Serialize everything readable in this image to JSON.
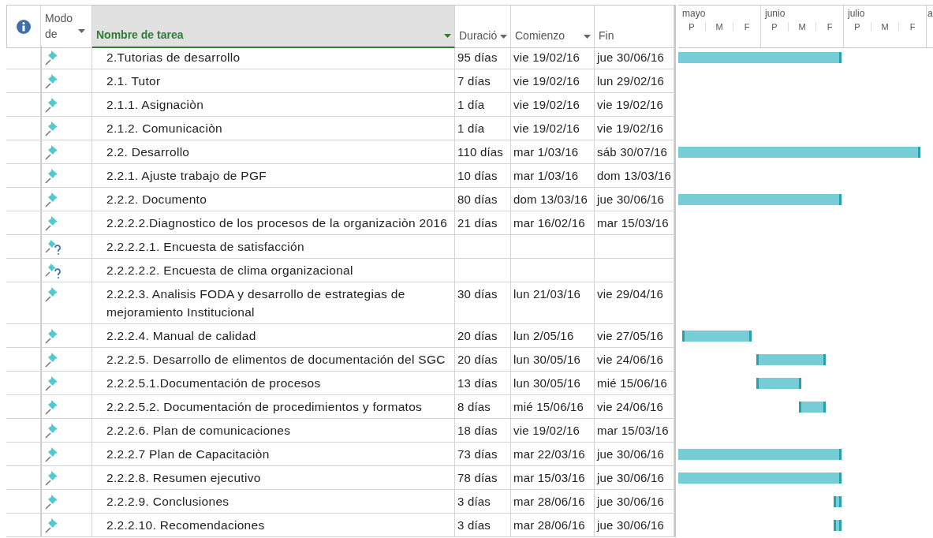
{
  "columns": [
    {
      "label": "Modo de",
      "dropdown": true,
      "selected": false
    },
    {
      "label": "Nombre de tarea",
      "dropdown": true,
      "selected": true
    },
    {
      "label": "Duració",
      "dropdown": true,
      "selected": false
    },
    {
      "label": "Comienzo",
      "dropdown": true,
      "selected": false
    },
    {
      "label": "Fin",
      "dropdown": false,
      "selected": false
    }
  ],
  "timescale": [
    {
      "month": "mayo",
      "ticks": [
        "P",
        "M",
        "F"
      ]
    },
    {
      "month": "junio",
      "ticks": [
        "P",
        "M",
        "F"
      ]
    },
    {
      "month": "julio",
      "ticks": [
        "P",
        "M",
        "F"
      ]
    },
    {
      "month": "a"
    }
  ],
  "tasks": [
    {
      "kind": "pin",
      "name": "2.Tutorias de desarrollo",
      "duration": "95 días",
      "start": "vie 19/02/16",
      "finish": "jue 30/06/16"
    },
    {
      "kind": "pin",
      "name": "2.1. Tutor",
      "duration": "7 días",
      "start": "vie 19/02/16",
      "finish": "lun 29/02/16"
    },
    {
      "kind": "pin",
      "name": "2.1.1. Asignaciòn",
      "duration": "1 día",
      "start": "vie 19/02/16",
      "finish": "vie 19/02/16"
    },
    {
      "kind": "pin",
      "name": "2.1.2. Comunicaciòn",
      "duration": "1 día",
      "start": "vie 19/02/16",
      "finish": "vie 19/02/16"
    },
    {
      "kind": "pin",
      "name": "2.2. Desarrollo",
      "duration": "110 días",
      "start": "mar 1/03/16",
      "finish": "sáb 30/07/16"
    },
    {
      "kind": "pin",
      "name": "2.2.1. Ajuste  trabajo de PGF",
      "duration": "10 días",
      "start": "mar 1/03/16",
      "finish": "dom 13/03/16"
    },
    {
      "kind": "pin",
      "name": "2.2.2. Documento",
      "duration": "80 días",
      "start": "dom 13/03/16",
      "finish": "jue 30/06/16"
    },
    {
      "kind": "pin",
      "name": "2.2.2.2.Diagnostico de los procesos de la organizaciòn  2016",
      "duration": "21 días",
      "start": "mar 16/02/16",
      "finish": "mar 15/03/16"
    },
    {
      "kind": "pin-question",
      "name": "2.2.2.2.1. Encuesta de satisfacción"
    },
    {
      "kind": "pin-question",
      "name": "2.2.2.2.2. Encuesta de clima organizacional"
    },
    {
      "kind": "pin",
      "name": "2.2.2.3. Analisis FODA y desarrollo de estrategias de mejoramiento Institucional",
      "duration": "30 días",
      "start": "lun 21/03/16",
      "finish": "vie 29/04/16"
    },
    {
      "kind": "pin",
      "name": "2.2.2.4. Manual de calidad",
      "duration": "20 días",
      "start": "lun 2/05/16",
      "finish": "vie 27/05/16"
    },
    {
      "kind": "pin",
      "name": "2.2.2.5. Desarrollo de elimentos de documentación del SGC",
      "duration": "20 días",
      "start": "lun 30/05/16",
      "finish": "vie 24/06/16"
    },
    {
      "kind": "pin",
      "name": "2.2.2.5.1.Documentación de procesos",
      "duration": "13 días",
      "start": "lun 30/05/16",
      "finish": "mié 15/06/16"
    },
    {
      "kind": "pin",
      "name": "2.2.2.5.2. Documentación de procedimientos y formatos",
      "duration": "8 días",
      "start": "mié 15/06/16",
      "finish": "vie 24/06/16"
    },
    {
      "kind": "pin",
      "name": "2.2.2.6. Plan de comunicaciones",
      "duration": "18 días",
      "start": "vie 19/02/16",
      "finish": "mar 15/03/16"
    },
    {
      "kind": "pin",
      "name": "2.2.2.7 Plan de Capacitaciòn",
      "duration": "73 días",
      "start": "mar 22/03/16",
      "finish": "jue 30/06/16"
    },
    {
      "kind": "pin",
      "name": "2.2.2.8. Resumen ejecutivo",
      "duration": "78 días",
      "start": "mar 15/03/16",
      "finish": "jue 30/06/16"
    },
    {
      "kind": "pin",
      "name": "2.2.2.9. Conclusiones",
      "duration": "3 días",
      "start": "mar 28/06/16",
      "finish": "jue 30/06/16"
    },
    {
      "kind": "pin",
      "name": "2.2.2.10. Recomendaciones",
      "duration": "3 días",
      "start": "mar 28/06/16",
      "finish": "jue 30/06/16"
    }
  ]
}
